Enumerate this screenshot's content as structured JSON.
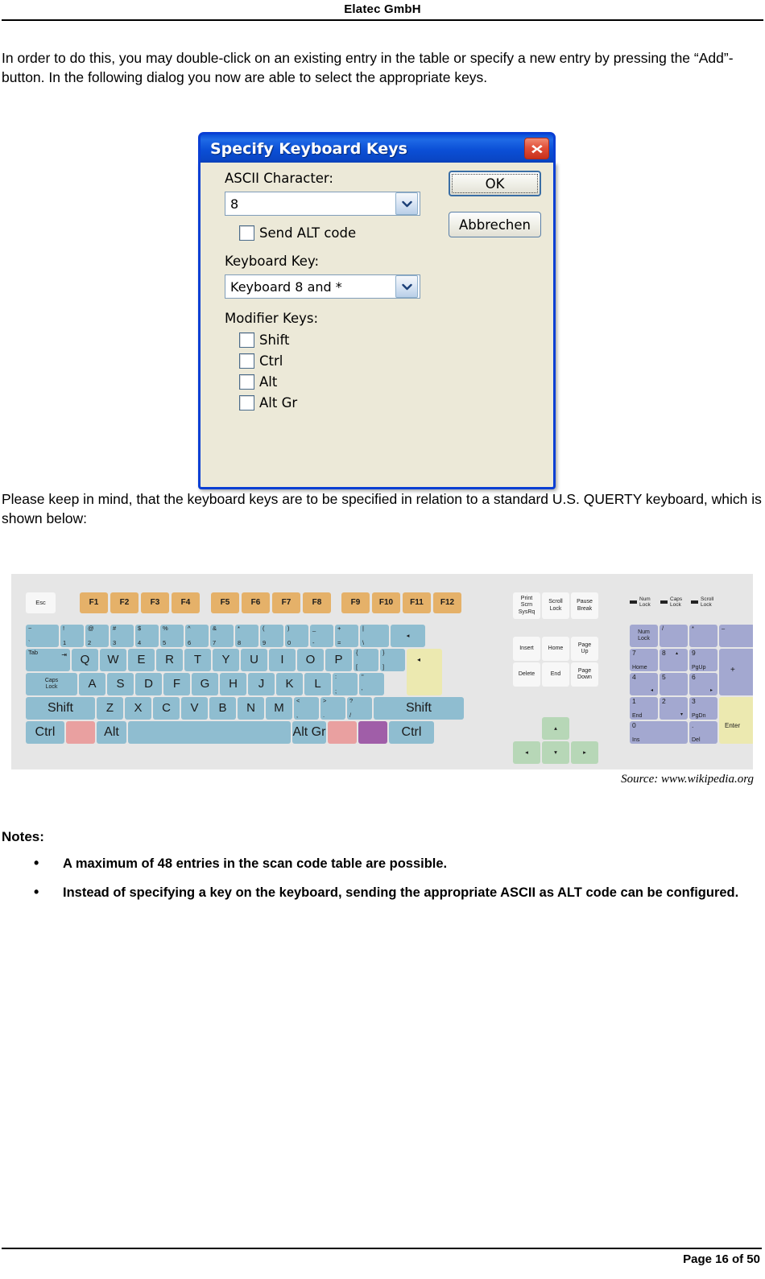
{
  "header": {
    "title": "Elatec GmbH"
  },
  "paragraphs": {
    "intro": "In order to do this, you may double-click on an existing entry in the table or specify a new entry by pressing the “Add”-button. In the following dialog you now are able to select the appropriate keys.",
    "querty": "Please keep in mind, that the keyboard keys are to be specified in relation to a standard U.S. QUERTY keyboard, which is shown below:"
  },
  "dialog": {
    "title": "Specify Keyboard Keys",
    "close_icon": "close-icon",
    "ascii_label": "ASCII Character:",
    "ascii_value": "8",
    "send_alt_label": "Send ALT code",
    "send_alt_checked": false,
    "keyboard_key_label": "Keyboard Key:",
    "keyboard_key_value": "Keyboard 8 and *",
    "modifier_label": "Modifier Keys:",
    "modifiers": [
      {
        "label": "Shift",
        "checked": false
      },
      {
        "label": "Ctrl",
        "checked": false
      },
      {
        "label": "Alt",
        "checked": false
      },
      {
        "label": "Alt Gr",
        "checked": false
      }
    ],
    "ok_label": "OK",
    "cancel_label": "Abbrechen",
    "colors": {
      "titlebar": "#0a50d8",
      "face": "#ece9d8",
      "close": "#c8301b",
      "border": "#0a3fd4"
    }
  },
  "keyboard": {
    "source_caption": "Source: www.wikipedia.org",
    "colors": {
      "alpha": "#8fbdd0",
      "function": "#e5b169",
      "nav": "#f7f7f7",
      "arrows": "#b7d7b7",
      "numpad": "#a3a8d0",
      "enter": "#ece9b0",
      "win_left": "#e9a0a0",
      "menu": "#a05ea8",
      "background": "#e6e6e6"
    },
    "escape": "Esc",
    "function_keys": [
      "F1",
      "F2",
      "F3",
      "F4",
      "F5",
      "F6",
      "F7",
      "F8",
      "F9",
      "F10",
      "F11",
      "F12"
    ],
    "number_row": [
      {
        "top": "~",
        "bottom": "`"
      },
      {
        "top": "!",
        "bottom": "1"
      },
      {
        "top": "@",
        "bottom": "2"
      },
      {
        "top": "#",
        "bottom": "3"
      },
      {
        "top": "$",
        "bottom": "4"
      },
      {
        "top": "%",
        "bottom": "5"
      },
      {
        "top": "^",
        "bottom": "6"
      },
      {
        "top": "&",
        "bottom": "7"
      },
      {
        "top": "*",
        "bottom": "8"
      },
      {
        "top": "(",
        "bottom": "9"
      },
      {
        "top": ")",
        "bottom": "0"
      },
      {
        "top": "_",
        "bottom": "-"
      },
      {
        "top": "+",
        "bottom": "="
      },
      {
        "top": "|",
        "bottom": "\\"
      }
    ],
    "backspace": "◂",
    "tab": "Tab",
    "qwerty_row": [
      "Q",
      "W",
      "E",
      "R",
      "T",
      "Y",
      "U",
      "I",
      "O",
      "P"
    ],
    "qwerty_brackets": [
      {
        "top": "{",
        "bottom": "["
      },
      {
        "top": "}",
        "bottom": "]"
      }
    ],
    "caps_lock": "Caps Lock",
    "home_row": [
      "A",
      "S",
      "D",
      "F",
      "G",
      "H",
      "J",
      "K",
      "L"
    ],
    "home_row_punct": [
      {
        "top": ":",
        "bottom": ";"
      },
      {
        "top": "\"",
        "bottom": "'"
      }
    ],
    "enter": "◂",
    "shift_left": "Shift",
    "bottom_letters": [
      "Z",
      "X",
      "C",
      "V",
      "B",
      "N",
      "M"
    ],
    "bottom_punct": [
      {
        "top": "<",
        "bottom": ","
      },
      {
        "top": ">",
        "bottom": "."
      },
      {
        "top": "?",
        "bottom": "/"
      }
    ],
    "shift_right": "Shift",
    "ctrl_left": "Ctrl",
    "alt_left": "Alt",
    "alt_gr": "Alt Gr",
    "ctrl_right": "Ctrl",
    "nav_top": [
      {
        "lines": [
          "Print",
          "Scrn",
          "SysRq"
        ]
      },
      {
        "lines": [
          "Scroll",
          "Lock"
        ]
      },
      {
        "lines": [
          "Pause",
          "Break"
        ]
      }
    ],
    "nav_block": [
      {
        "lines": [
          "Insert"
        ]
      },
      {
        "lines": [
          "Home"
        ]
      },
      {
        "lines": [
          "Page",
          "Up"
        ]
      },
      {
        "lines": [
          "Delete"
        ]
      },
      {
        "lines": [
          "End"
        ]
      },
      {
        "lines": [
          "Page",
          "Down"
        ]
      }
    ],
    "arrows": {
      "up": "▴",
      "left": "◂",
      "down": "▾",
      "right": "▸"
    },
    "leds": [
      {
        "lines": [
          "Num",
          "Lock"
        ]
      },
      {
        "lines": [
          "Caps",
          "Lock"
        ]
      },
      {
        "lines": [
          "Scroll",
          "Lock"
        ]
      }
    ],
    "numpad": {
      "num_lock": "Num Lock",
      "divide": "/",
      "multiply": "*",
      "minus": "–",
      "plus": "+",
      "enter": "Enter",
      "keys": [
        {
          "main": "7",
          "sub": "Home"
        },
        {
          "main": "8",
          "sub": "",
          "arrow": "▴"
        },
        {
          "main": "9",
          "sub": "PgUp"
        },
        {
          "main": "4",
          "sub": "",
          "arrow": "◂"
        },
        {
          "main": "5",
          "sub": ""
        },
        {
          "main": "6",
          "sub": "",
          "arrow": "▸"
        },
        {
          "main": "1",
          "sub": "End"
        },
        {
          "main": "2",
          "sub": "",
          "arrow": "▾"
        },
        {
          "main": "3",
          "sub": "PgDn"
        },
        {
          "main": "0",
          "sub": "Ins"
        },
        {
          "main": ".",
          "sub": "Del"
        }
      ]
    }
  },
  "notes": {
    "title": "Notes:",
    "bullet": "•",
    "items": [
      "A maximum of 48 entries in the scan code table are possible.",
      "Instead of specifying a key on the keyboard, sending the appropriate ASCII as ALT code can be configured."
    ]
  },
  "footer": {
    "page_label": "Page 16 of 50"
  }
}
